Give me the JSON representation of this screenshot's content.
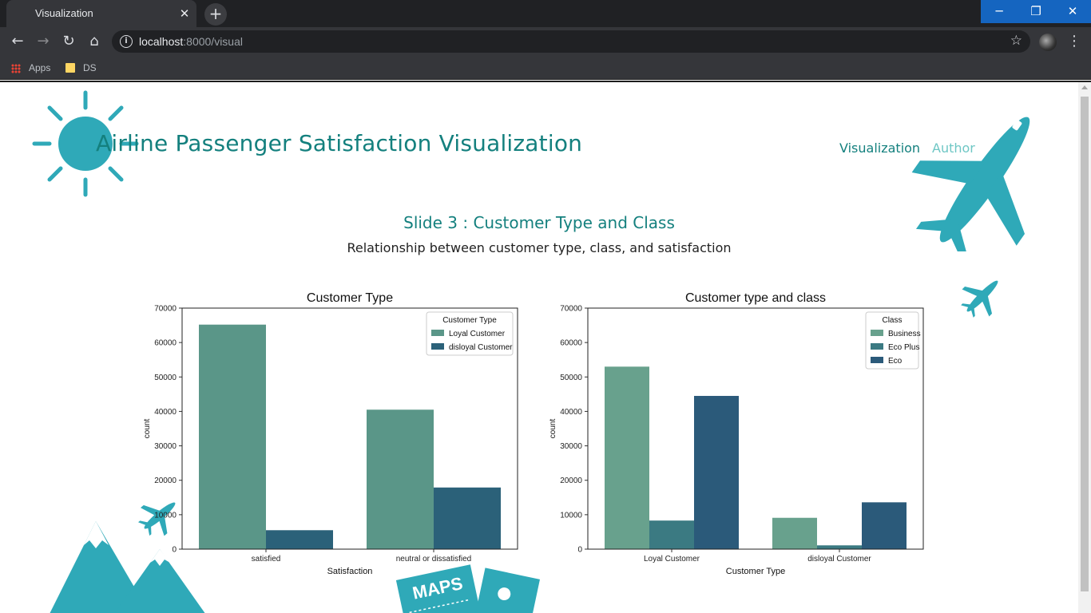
{
  "browser": {
    "tab_title": "Visualization",
    "url_host": "localhost",
    "url_path": ":8000/visual",
    "bookmarks": [
      "Apps",
      "DS"
    ]
  },
  "site": {
    "title": "Airline Passenger Satisfaction Visualization",
    "nav": [
      "Visualization",
      "Author"
    ]
  },
  "slide": {
    "title": "Slide 3 : Customer Type and Class",
    "subtitle": "Relationship between customer type, class, and satisfaction"
  },
  "colors": {
    "accent": "#14807e",
    "decoration": "#2fa9b8"
  },
  "decorations": {
    "maps_label": "MAPS"
  },
  "chart_data": [
    {
      "type": "bar",
      "title": "Customer Type",
      "xlabel": "Satisfaction",
      "ylabel": "count",
      "ylim": [
        0,
        70000
      ],
      "yticks": [
        0,
        10000,
        20000,
        30000,
        40000,
        50000,
        60000,
        70000
      ],
      "categories": [
        "satisfied",
        "neutral or dissatisfied"
      ],
      "legend_title": "Customer Type",
      "legend_position": "top-right",
      "series": [
        {
          "name": "Loyal Customer",
          "color": "#5a9688",
          "values": [
            65200,
            40500
          ]
        },
        {
          "name": "disloyal Customer",
          "color": "#2b6179",
          "values": [
            5500,
            17900
          ]
        }
      ]
    },
    {
      "type": "bar",
      "title": "Customer type and class",
      "xlabel": "Customer Type",
      "ylabel": "count",
      "ylim": [
        0,
        70000
      ],
      "yticks": [
        0,
        10000,
        20000,
        30000,
        40000,
        50000,
        60000,
        70000
      ],
      "categories": [
        "Loyal Customer",
        "disloyal Customer"
      ],
      "legend_title": "Class",
      "legend_position": "top-right",
      "series": [
        {
          "name": "Business",
          "color": "#68a18d",
          "values": [
            53000,
            9100
          ]
        },
        {
          "name": "Eco Plus",
          "color": "#3b7a82",
          "values": [
            8300,
            1100
          ]
        },
        {
          "name": "Eco",
          "color": "#2b5a7a",
          "values": [
            44500,
            13600
          ]
        }
      ]
    }
  ]
}
